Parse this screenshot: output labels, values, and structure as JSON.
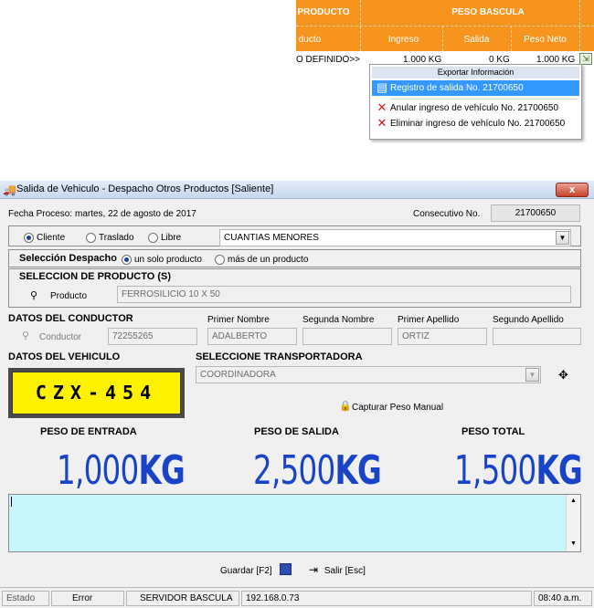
{
  "top_grid": {
    "headers": {
      "producto": "PRODUCTO",
      "peso_bascula": "PESO BASCULA"
    },
    "subheaders": {
      "producto": "ducto",
      "ingreso": "Ingreso",
      "salida": "Salida",
      "peso_neto": "Peso Neto"
    },
    "row": {
      "producto": "O DEFINIDO>>",
      "ingreso": "1.000 KG",
      "salida": "0 KG",
      "peso_neto": "1.000 KG"
    }
  },
  "context_menu": {
    "title": "Exportar Información",
    "items": [
      {
        "label": "Registro de salida No. 21700650",
        "icon": "export-doc-icon"
      },
      {
        "label": "Anular ingreso de vehículo No. 21700650",
        "icon": "red-x-icon"
      },
      {
        "label": "Eliminar ingreso de vehículo No. 21700650",
        "icon": "red-x-icon"
      }
    ]
  },
  "window": {
    "title": "Salida de Vehiculo - Despacho Otros Productos [Saliente]",
    "close": "x"
  },
  "header": {
    "fecha_label": "Fecha Proceso:",
    "fecha_value": "martes, 22 de agosto de 2017",
    "consecutivo_label": "Consecutivo No.",
    "consecutivo_value": "21700650"
  },
  "tipo": {
    "options": [
      "Cliente",
      "Traslado",
      "Libre"
    ],
    "selected": "Cliente",
    "combo_value": "CUANTIAS MENORES"
  },
  "despacho": {
    "label": "Selección Despacho",
    "options": [
      "un solo producto",
      "más de un producto"
    ],
    "selected": "un solo producto"
  },
  "producto": {
    "section_title": "SELECCION DE PRODUCTO (S)",
    "label": "Producto",
    "value": "FERROSILICIO 10 X 50"
  },
  "conductor": {
    "section_title": "DATOS DEL CONDUCTOR",
    "label": "Conductor",
    "id_value": "72255265",
    "col_labels": [
      "Primer Nombre",
      "Segunda Nombre",
      "Primer Apellido",
      "Segundo Apellido"
    ],
    "values": [
      "ADALBERTO",
      "",
      "ORTIZ",
      ""
    ]
  },
  "vehiculo": {
    "section_title": "DATOS DEL VEHICULO",
    "plate": "CZX-454",
    "transportadora_title": "SELECCIONE TRANSPORTADORA",
    "transportadora_value": "COORDINADORA",
    "capturar_label": "Capturar Peso Manual"
  },
  "pesos": {
    "entrada_label": "PESO DE ENTRADA",
    "salida_label": "PESO DE SALIDA",
    "total_label": "PESO TOTAL",
    "entrada_num": "1,000",
    "salida_num": "2,500",
    "total_num": "1,500",
    "unit": "KG"
  },
  "buttons": {
    "guardar": "Guardar [F2]",
    "salir": "Salir [Esc]"
  },
  "statusbar": {
    "estado": "Estado",
    "error": "Error",
    "servidor": "SERVIDOR BASCULA",
    "ip": "192.168.0.73",
    "time": "08:40 a.m."
  },
  "colors": {
    "grid_header": "#f7941d",
    "menu_highlight": "#3399ff",
    "weight_blue": "#1a44c8",
    "plate_yellow": "#fff200",
    "memo_cyan": "#c8f7fb"
  }
}
